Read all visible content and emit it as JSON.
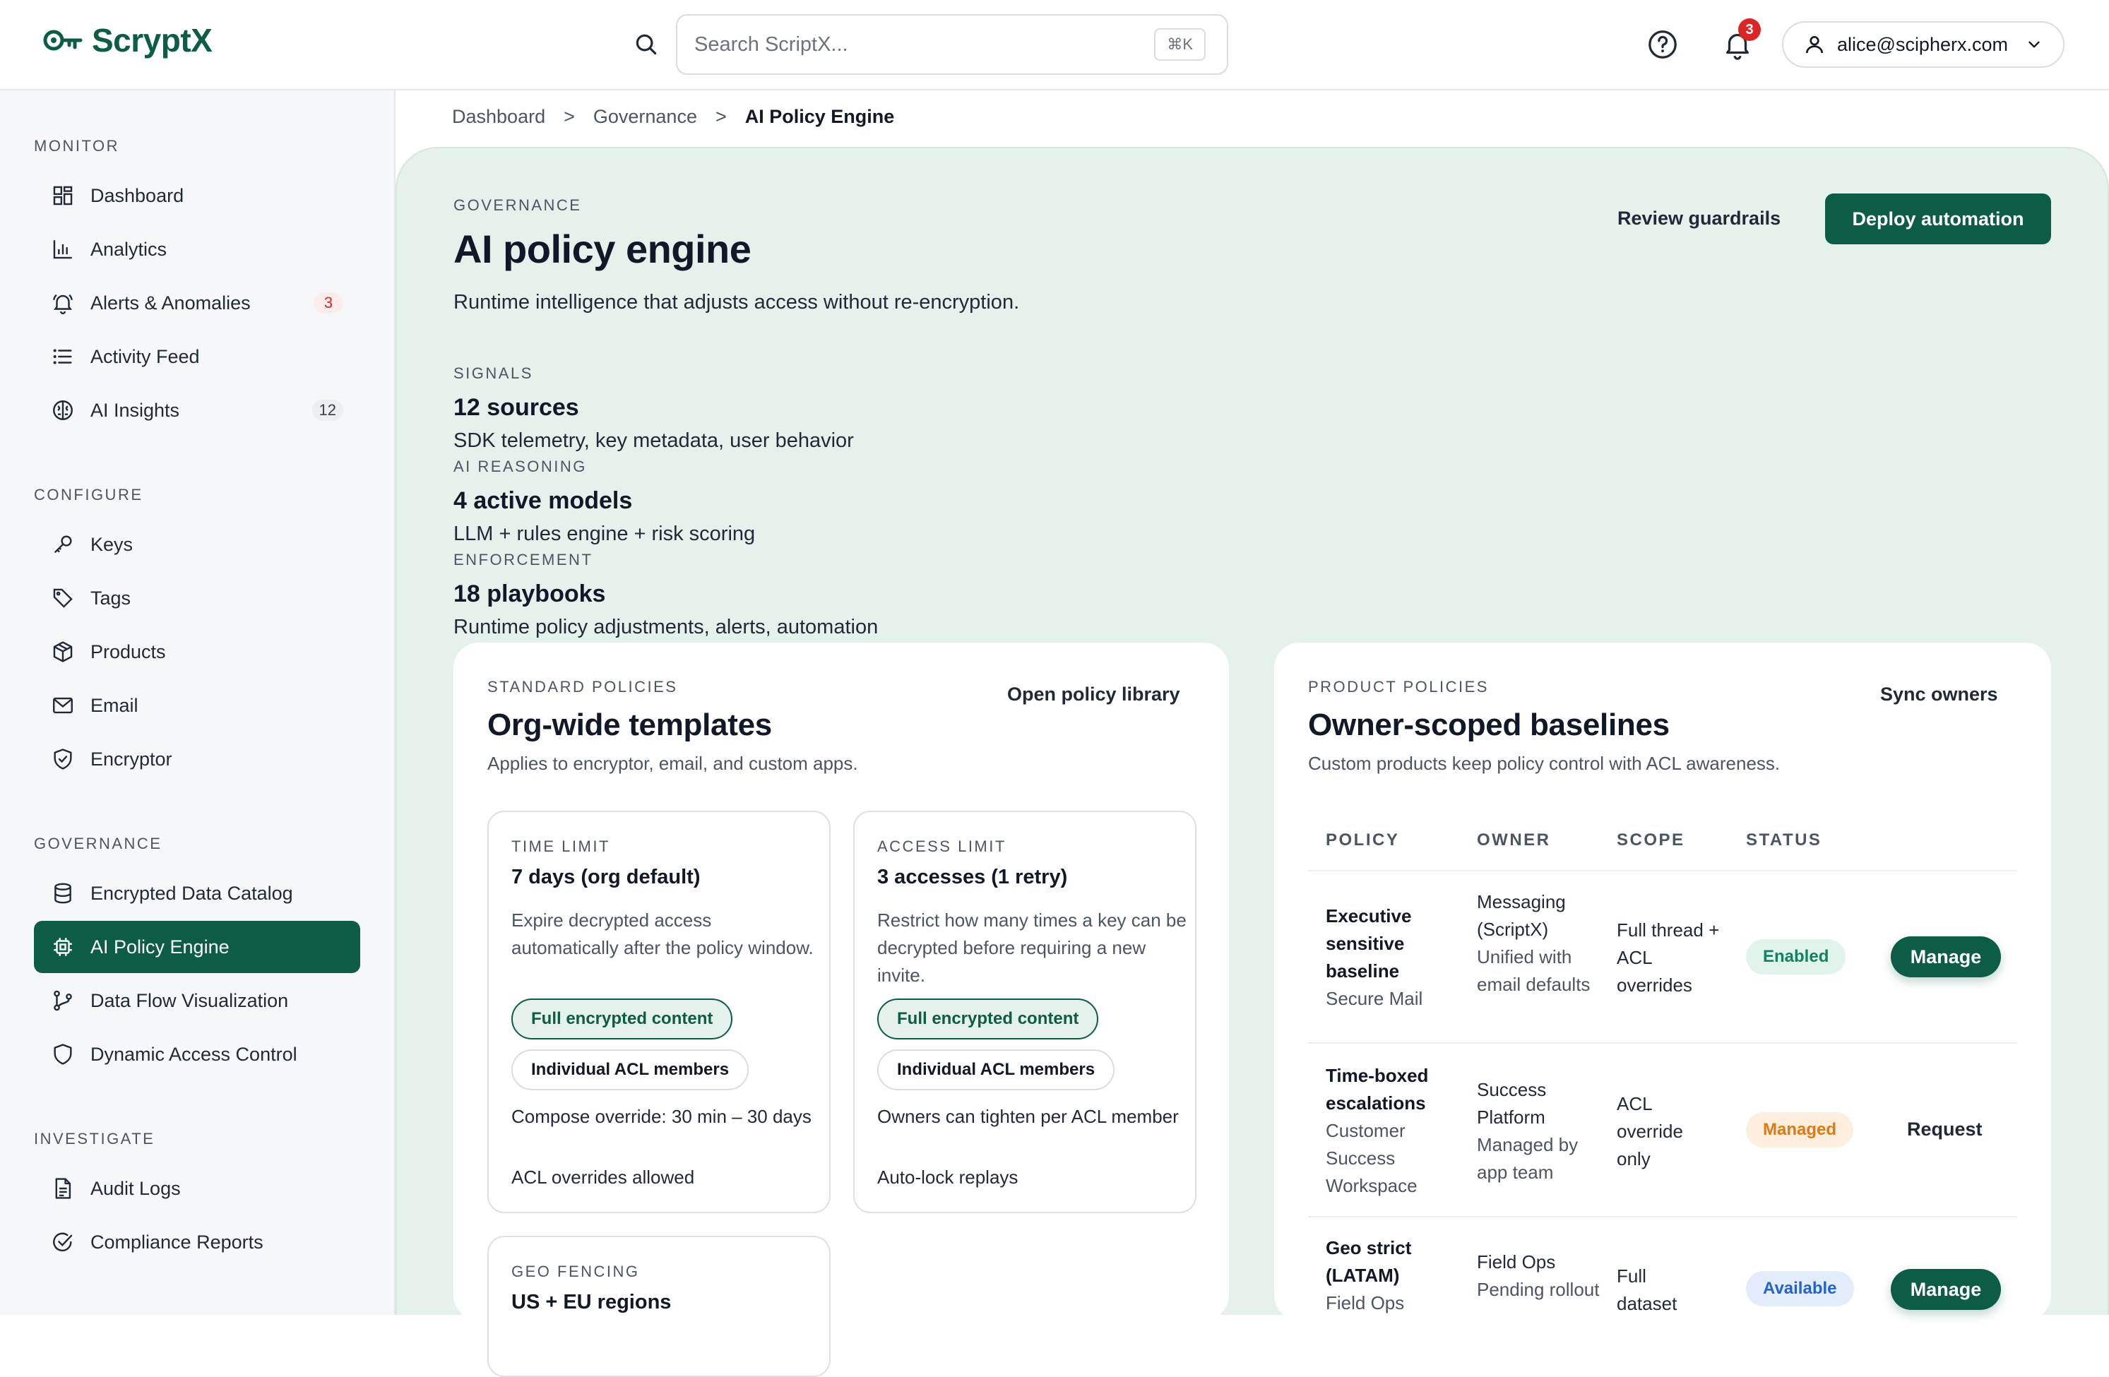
{
  "app": {
    "name": "ScryptX"
  },
  "search": {
    "placeholder": "Search ScriptX...",
    "shortcut": "⌘K"
  },
  "header": {
    "notifications_count": "3",
    "user_email": "alice@scipherx.com"
  },
  "sidebar": {
    "sections": [
      {
        "title": "MONITOR",
        "items": [
          {
            "label": "Dashboard",
            "icon": "dashboard-icon"
          },
          {
            "label": "Analytics",
            "icon": "bar-chart-icon"
          },
          {
            "label": "Alerts & Anomalies",
            "icon": "bell-icon",
            "count": "3"
          },
          {
            "label": "Activity Feed",
            "icon": "list-icon"
          },
          {
            "label": "AI Insights",
            "icon": "brain-icon",
            "count": "12"
          }
        ]
      },
      {
        "title": "CONFIGURE",
        "items": [
          {
            "label": "Keys",
            "icon": "key-icon"
          },
          {
            "label": "Tags",
            "icon": "tag-icon"
          },
          {
            "label": "Products",
            "icon": "package-icon"
          },
          {
            "label": "Email",
            "icon": "mail-icon"
          },
          {
            "label": "Encryptor",
            "icon": "shield-check-icon"
          }
        ]
      },
      {
        "title": "GOVERNANCE",
        "items": [
          {
            "label": "Encrypted Data Catalog",
            "icon": "database-icon"
          },
          {
            "label": "AI Policy Engine",
            "icon": "cpu-icon",
            "active": true
          },
          {
            "label": "Data Flow Visualization",
            "icon": "flow-icon"
          },
          {
            "label": "Dynamic Access Control",
            "icon": "shield-icon"
          }
        ]
      },
      {
        "title": "INVESTIGATE",
        "items": [
          {
            "label": "Audit Logs",
            "icon": "document-icon"
          },
          {
            "label": "Compliance Reports",
            "icon": "check-circle-icon"
          }
        ]
      }
    ]
  },
  "breadcrumb": [
    "Dashboard",
    "Governance",
    "AI Policy Engine"
  ],
  "breadcrumb_sep": ">",
  "page": {
    "eyebrow": "GOVERNANCE",
    "title": "AI policy engine",
    "subtitle": "Runtime intelligence that adjusts access without re-encryption.",
    "review_label": "Review guardrails",
    "deploy_label": "Deploy automation"
  },
  "stats": [
    {
      "label": "SIGNALS",
      "value": "12 sources",
      "desc": "SDK telemetry, key metadata, user behavior"
    },
    {
      "label": "AI REASONING",
      "value": "4 active models",
      "desc": "LLM + rules engine + risk scoring"
    },
    {
      "label": "ENFORCEMENT",
      "value": "18 playbooks",
      "desc": "Runtime policy adjustments, alerts, automation"
    }
  ],
  "standard": {
    "eyebrow": "STANDARD POLICIES",
    "title": "Org-wide templates",
    "desc": "Applies to encryptor, email, and custom apps.",
    "link": "Open policy library",
    "tiles": [
      {
        "eyebrow": "TIME LIMIT",
        "title": "7 days (org default)",
        "desc": "Expire decrypted access automatically after the policy window.",
        "chip_on": "Full encrypted content",
        "chip_off": "Individual ACL members",
        "note1": "Compose override: 30 min – 30 days",
        "note2": "ACL overrides allowed"
      },
      {
        "eyebrow": "ACCESS LIMIT",
        "title": "3 accesses (1 retry)",
        "desc": "Restrict how many times a key can be decrypted before requiring a new invite.",
        "chip_on": "Full encrypted content",
        "chip_off": "Individual ACL members",
        "note1": "Owners can tighten per ACL member",
        "note2": "Auto-lock replays"
      },
      {
        "eyebrow": "GEO FENCING",
        "title": "US + EU regions"
      }
    ]
  },
  "product": {
    "eyebrow": "PRODUCT POLICIES",
    "title": "Owner-scoped baselines",
    "desc": "Custom products keep policy control with ACL awareness.",
    "link": "Sync owners",
    "columns": [
      "POLICY",
      "OWNER",
      "SCOPE",
      "STATUS"
    ],
    "rows": [
      {
        "policy": "Executive sensitive baseline",
        "policy_sub": "Secure Mail",
        "owner": "Messaging (ScriptX)",
        "owner_sub": "Unified with email defaults",
        "scope": "Full thread + ACL overrides",
        "status": "Enabled",
        "action": "Manage"
      },
      {
        "policy": "Time-boxed escalations",
        "policy_sub": "Customer Success Workspace",
        "owner": "Success Platform",
        "owner_sub": "Managed by app team",
        "scope": "ACL override only",
        "status": "Managed",
        "action": "Request"
      },
      {
        "policy": "Geo strict (LATAM)",
        "policy_sub": "Field Ops",
        "owner": "Field Ops",
        "owner_sub": "Pending rollout",
        "scope": "Full dataset",
        "status": "Available",
        "action": "Manage"
      }
    ]
  },
  "colors": {
    "brand": "#0d5c45",
    "panel": "#e5f2ec",
    "alert": "#dc2626"
  }
}
